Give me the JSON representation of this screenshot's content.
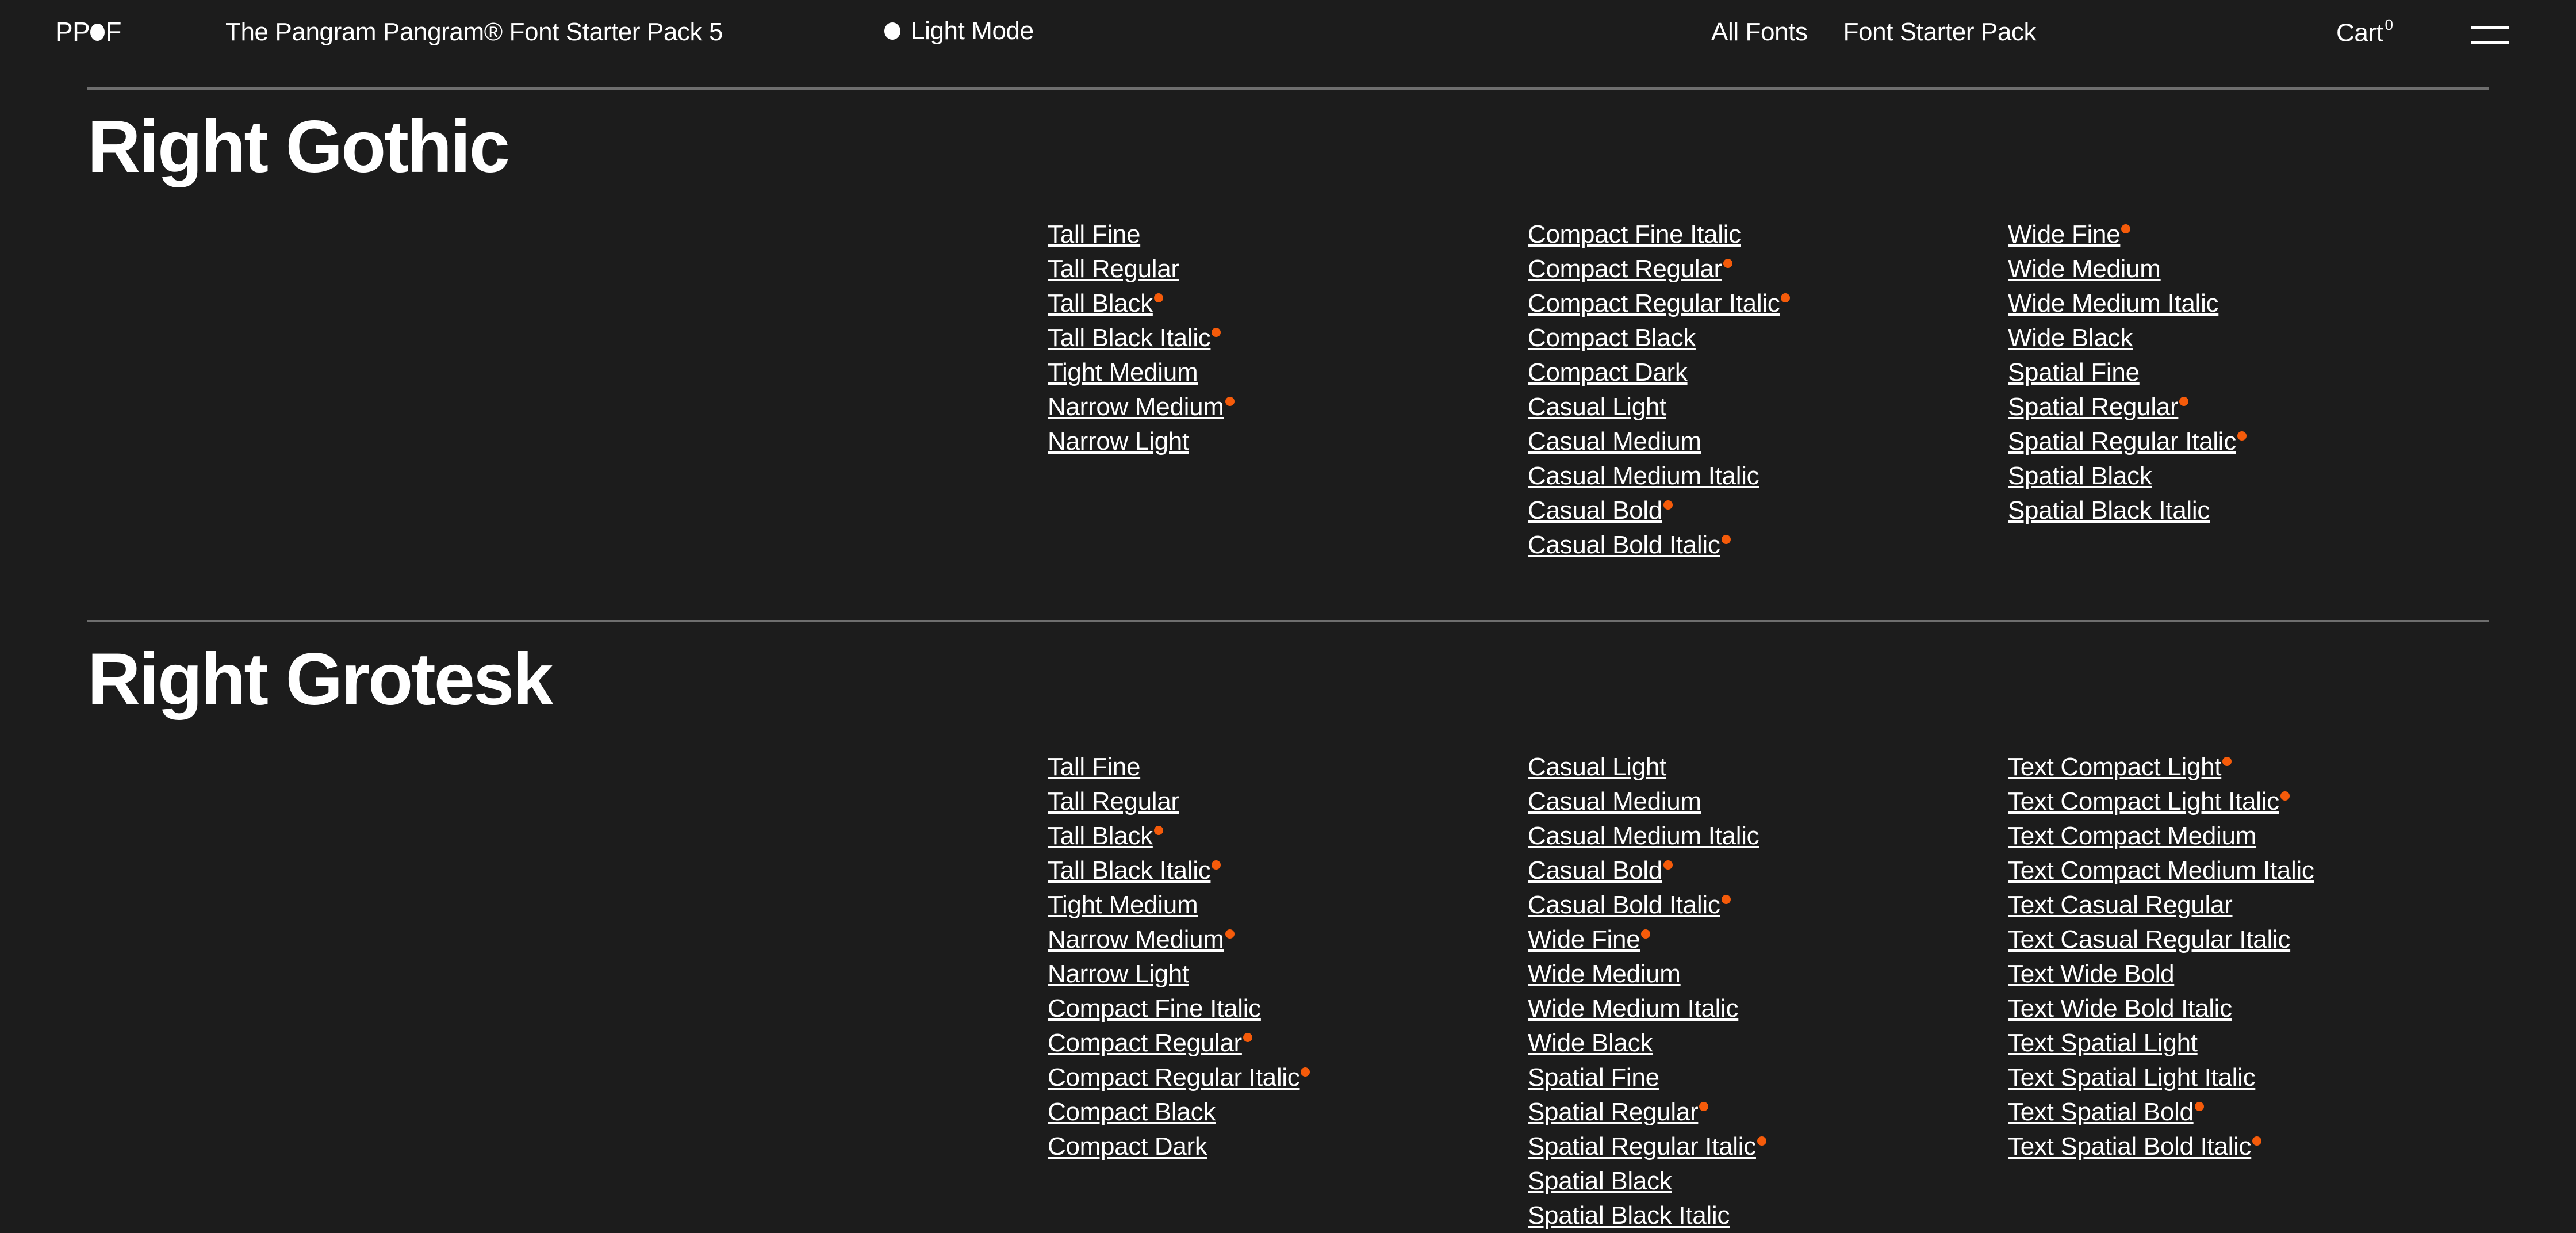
{
  "header": {
    "logo_text_left": "PP",
    "logo_text_right": "F",
    "logo_icon": "circle-dot-icon",
    "pack_title": "The Pangram Pangram® Font Starter Pack 5",
    "mode_toggle_label": "Light Mode",
    "mode_toggle_icon": "filled-circle-icon",
    "nav": [
      {
        "label": "All Fonts"
      },
      {
        "label": "Font Starter Pack"
      }
    ],
    "cart_label": "Cart",
    "cart_count": "0",
    "menu_icon": "hamburger-menu-icon"
  },
  "colors": {
    "background": "#1c1c1c",
    "text": "#ffffff",
    "accent_dot": "#f55b0a",
    "divider": "#6e6e6e"
  },
  "sections": [
    {
      "family": "Right Gothic",
      "columns": [
        [
          {
            "label": "Tall Fine",
            "dot": false
          },
          {
            "label": "Tall Regular",
            "dot": false
          },
          {
            "label": "Tall Black",
            "dot": true
          },
          {
            "label": "Tall Black Italic",
            "dot": true
          },
          {
            "label": "Tight Medium",
            "dot": false
          },
          {
            "label": "Narrow Medium",
            "dot": true
          },
          {
            "label": "Narrow Light",
            "dot": false
          }
        ],
        [
          {
            "label": "Compact Fine Italic",
            "dot": false
          },
          {
            "label": "Compact Regular",
            "dot": true
          },
          {
            "label": "Compact Regular Italic",
            "dot": true
          },
          {
            "label": "Compact Black",
            "dot": false
          },
          {
            "label": "Compact Dark",
            "dot": false
          },
          {
            "label": "Casual Light",
            "dot": false
          },
          {
            "label": "Casual Medium",
            "dot": false
          },
          {
            "label": "Casual Medium Italic",
            "dot": false
          },
          {
            "label": "Casual Bold",
            "dot": true
          },
          {
            "label": "Casual Bold Italic",
            "dot": true
          }
        ],
        [
          {
            "label": "Wide Fine",
            "dot": true
          },
          {
            "label": "Wide Medium",
            "dot": false
          },
          {
            "label": "Wide Medium Italic",
            "dot": false
          },
          {
            "label": "Wide Black",
            "dot": false
          },
          {
            "label": "Spatial Fine",
            "dot": false
          },
          {
            "label": "Spatial Regular",
            "dot": true
          },
          {
            "label": "Spatial Regular Italic",
            "dot": true
          },
          {
            "label": "Spatial Black",
            "dot": false
          },
          {
            "label": "Spatial Black Italic",
            "dot": false
          }
        ]
      ]
    },
    {
      "family": "Right Grotesk",
      "columns": [
        [
          {
            "label": "Tall Fine",
            "dot": false
          },
          {
            "label": "Tall Regular",
            "dot": false
          },
          {
            "label": "Tall Black",
            "dot": true
          },
          {
            "label": "Tall Black Italic",
            "dot": true
          },
          {
            "label": "Tight Medium",
            "dot": false
          },
          {
            "label": "Narrow Medium",
            "dot": true
          },
          {
            "label": "Narrow Light",
            "dot": false
          },
          {
            "label": "Compact Fine Italic",
            "dot": false
          },
          {
            "label": "Compact Regular",
            "dot": true
          },
          {
            "label": "Compact Regular Italic",
            "dot": true
          },
          {
            "label": "Compact Black",
            "dot": false
          },
          {
            "label": "Compact Dark",
            "dot": false
          }
        ],
        [
          {
            "label": "Casual Light",
            "dot": false
          },
          {
            "label": "Casual Medium",
            "dot": false
          },
          {
            "label": "Casual Medium Italic",
            "dot": false
          },
          {
            "label": "Casual Bold",
            "dot": true
          },
          {
            "label": "Casual Bold Italic",
            "dot": true
          },
          {
            "label": "Wide Fine",
            "dot": true
          },
          {
            "label": "Wide Medium",
            "dot": false
          },
          {
            "label": "Wide Medium Italic",
            "dot": false
          },
          {
            "label": "Wide Black",
            "dot": false
          },
          {
            "label": "Spatial Fine",
            "dot": false
          },
          {
            "label": "Spatial Regular",
            "dot": true
          },
          {
            "label": "Spatial Regular Italic",
            "dot": true
          },
          {
            "label": "Spatial Black",
            "dot": false
          },
          {
            "label": "Spatial Black Italic",
            "dot": false
          }
        ],
        [
          {
            "label": "Text Compact Light",
            "dot": true
          },
          {
            "label": "Text Compact Light Italic",
            "dot": true
          },
          {
            "label": "Text Compact Medium",
            "dot": false
          },
          {
            "label": "Text Compact Medium Italic",
            "dot": false
          },
          {
            "label": "Text Casual Regular",
            "dot": false
          },
          {
            "label": "Text Casual Regular Italic",
            "dot": false
          },
          {
            "label": "Text Wide Bold",
            "dot": false
          },
          {
            "label": "Text Wide Bold Italic",
            "dot": false
          },
          {
            "label": "Text Spatial Light",
            "dot": false
          },
          {
            "label": "Text Spatial Light Italic",
            "dot": false
          },
          {
            "label": "Text Spatial Bold",
            "dot": true
          },
          {
            "label": "Text Spatial Bold Italic",
            "dot": true
          }
        ]
      ]
    }
  ]
}
